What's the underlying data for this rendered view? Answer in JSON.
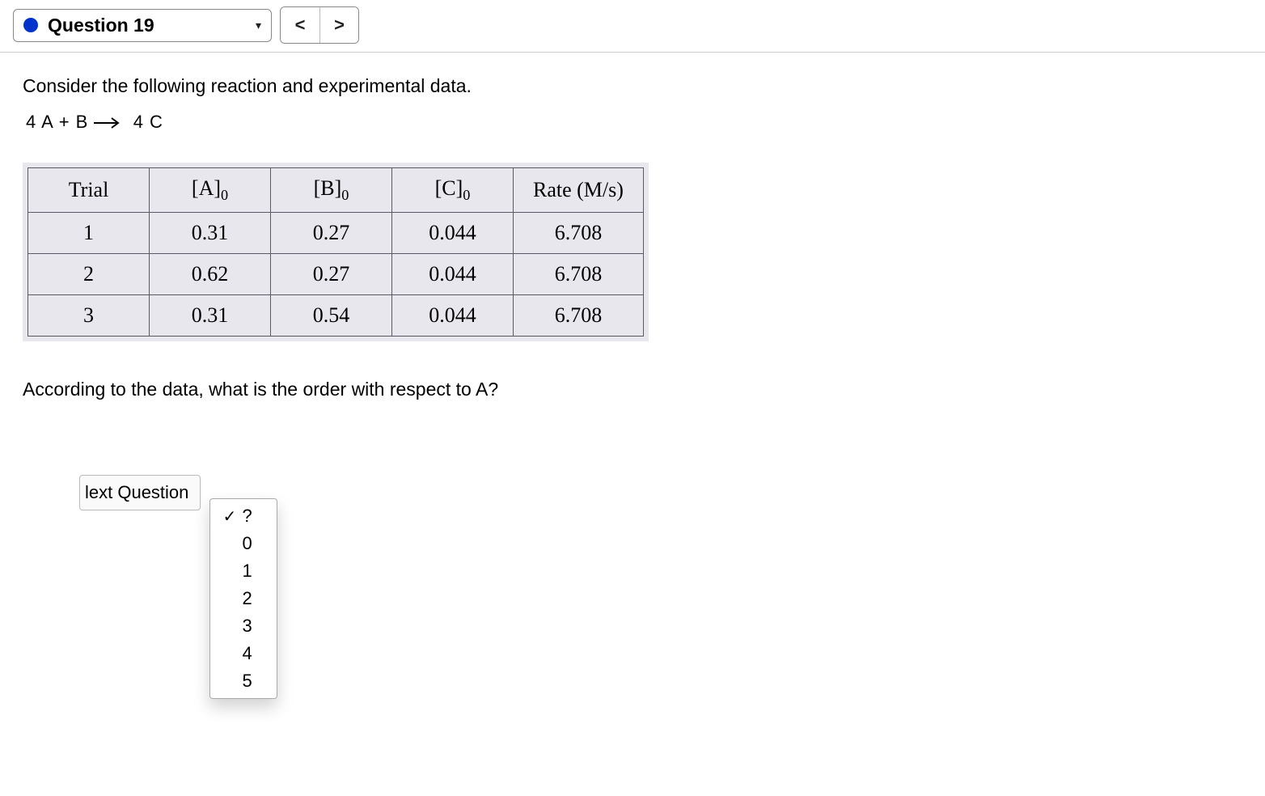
{
  "header": {
    "question_label": "Question 19",
    "prev_glyph": "<",
    "next_glyph": ">"
  },
  "body": {
    "intro": "Consider the following reaction and experimental data.",
    "equation_lhs": "4 A + B",
    "equation_rhs": "4 C",
    "question2": "According to the data, what is the order with respect to A?"
  },
  "table": {
    "headers": {
      "trial": "Trial",
      "a_base": "[A]",
      "a_sub": "0",
      "b_base": "[B]",
      "b_sub": "0",
      "c_base": "[C]",
      "c_sub": "0",
      "rate": "Rate (M/s)"
    },
    "rows": [
      {
        "trial": "1",
        "a": "0.31",
        "b": "0.27",
        "c": "0.044",
        "rate": "6.708"
      },
      {
        "trial": "2",
        "a": "0.62",
        "b": "0.27",
        "c": "0.044",
        "rate": "6.708"
      },
      {
        "trial": "3",
        "a": "0.31",
        "b": "0.54",
        "c": "0.044",
        "rate": "6.708"
      }
    ]
  },
  "chart_data": {
    "type": "table",
    "columns": [
      "Trial",
      "[A]0",
      "[B]0",
      "[C]0",
      "Rate (M/s)"
    ],
    "rows": [
      [
        1,
        0.31,
        0.27,
        0.044,
        6.708
      ],
      [
        2,
        0.62,
        0.27,
        0.044,
        6.708
      ],
      [
        3,
        0.31,
        0.54,
        0.044,
        6.708
      ]
    ]
  },
  "answer_select": {
    "selected_label": "?",
    "check_glyph": "✓",
    "options": [
      "?",
      "0",
      "1",
      "2",
      "3",
      "4",
      "5"
    ]
  },
  "next_button_label": "lext Question"
}
